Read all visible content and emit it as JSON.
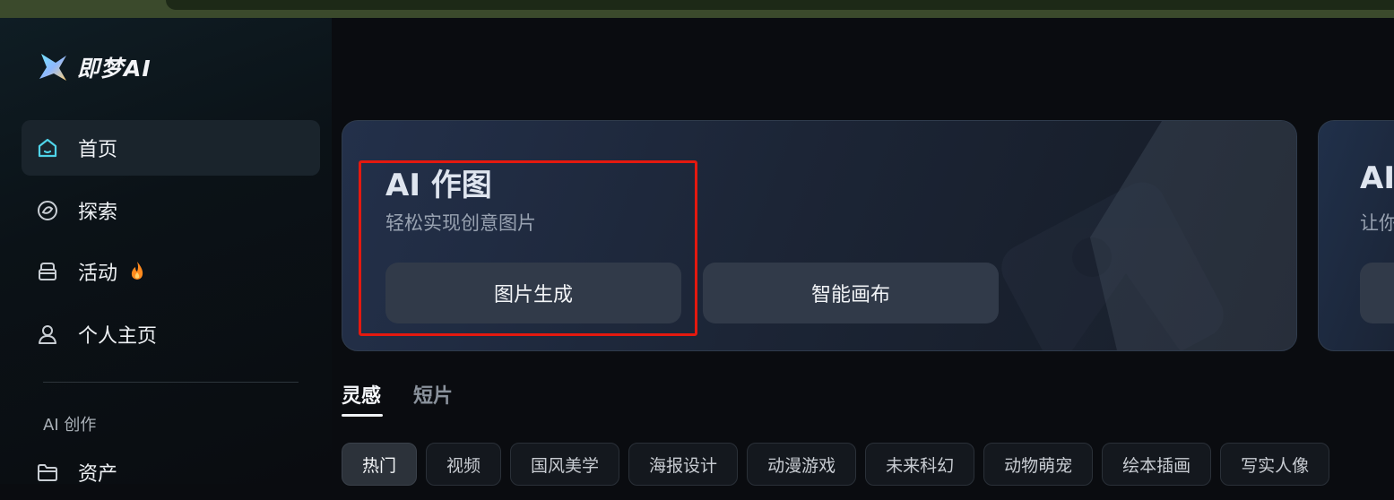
{
  "brand": {
    "name": "即梦AI"
  },
  "sidebar": {
    "items": [
      {
        "label": "首页",
        "icon": "home-icon",
        "active": true
      },
      {
        "label": "探索",
        "icon": "explore-icon"
      },
      {
        "label": "活动",
        "icon": "gift-icon",
        "badge_icon": "flame-icon"
      },
      {
        "label": "个人主页",
        "icon": "user-icon"
      }
    ],
    "section_title": "AI 创作",
    "section_items": [
      {
        "label": "资产",
        "icon": "folder-icon"
      }
    ]
  },
  "cards": [
    {
      "title": "AI 作图",
      "subtitle": "轻松实现创意图片",
      "buttons": [
        "图片生成",
        "智能画布"
      ]
    },
    {
      "title": "AI",
      "subtitle": "让你",
      "buttons": [
        ""
      ]
    }
  ],
  "tabs": [
    "灵感",
    "短片"
  ],
  "chips": [
    "热门",
    "视频",
    "国风美学",
    "海报设计",
    "动漫游戏",
    "未来科幻",
    "动物萌宠",
    "绘本插画",
    "写实人像"
  ],
  "colors": {
    "highlight": "#e4190f",
    "accent_icon": "#4fd3e8",
    "flame": "#ff8a1e"
  }
}
